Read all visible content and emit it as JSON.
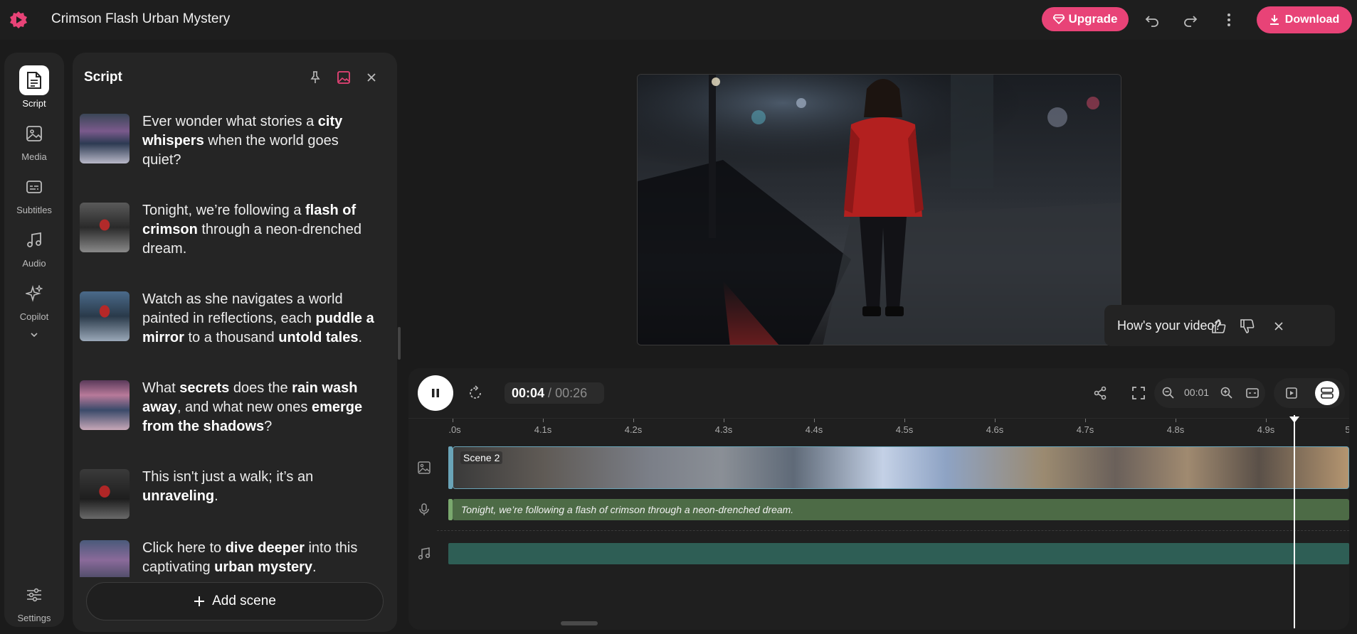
{
  "app": {
    "title": "Crimson Flash Urban Mystery",
    "accent_color": "#e84377",
    "upgrade_label": "Upgrade",
    "download_label": "Download"
  },
  "rail": {
    "items": [
      {
        "label": "Script",
        "icon": "script-icon",
        "active": true
      },
      {
        "label": "Media",
        "icon": "image-icon"
      },
      {
        "label": "Subtitles",
        "icon": "subtitles-icon"
      },
      {
        "label": "Audio",
        "icon": "music-note-icon"
      },
      {
        "label": "Copilot",
        "icon": "sparkle-icon"
      }
    ],
    "settings_label": "Settings"
  },
  "script": {
    "title": "Script",
    "add_scene_label": "Add scene",
    "scenes": [
      {
        "html": "Ever wonder what stories a <b>city whispers</b> when the world goes quiet?"
      },
      {
        "html": "Tonight, we’re following a <b>flash of crimson</b> through a neon-drenched dream."
      },
      {
        "html": "Watch as she navigates a world painted in reflections, each <b>puddle a mirror</b> to a thousand <b>untold tales</b>."
      },
      {
        "html": "What <b>secrets</b> does the <b>rain wash away</b>, and what new ones <b>emerge from the shadows</b>?"
      },
      {
        "html": "This isn't just a walk; it’s an <b>unraveling</b>."
      },
      {
        "html": "Click here to <b>dive deeper</b> into this captivating <b>urban mystery</b>."
      }
    ]
  },
  "feedback": {
    "question": "How's your video?"
  },
  "player": {
    "current_time": "00:04",
    "separator": "/",
    "total_time": "00:26",
    "zoom_value": "00:01"
  },
  "timeline": {
    "ticks": [
      ".0s",
      "4.1s",
      "4.2s",
      "4.3s",
      "4.4s",
      "4.5s",
      "4.6s",
      "4.7s",
      "4.8s",
      "4.9s",
      "5"
    ],
    "scene_clip_label": "Scene 2",
    "voice_clip_text": "Tonight, we’re following a flash of crimson through a neon-drenched dream."
  }
}
